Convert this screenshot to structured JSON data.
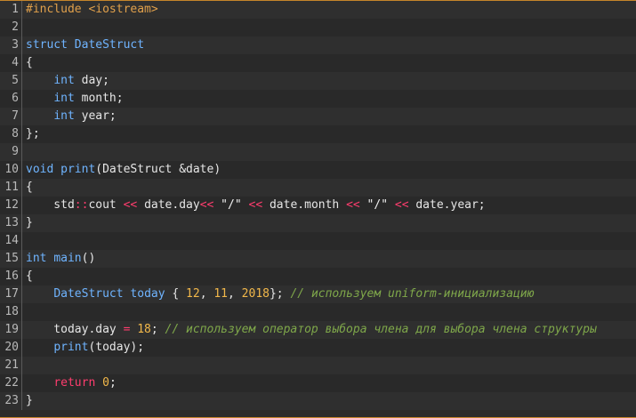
{
  "lines": [
    {
      "n": "1",
      "tokens": [
        {
          "t": "#include <iostream>",
          "c": "pre"
        }
      ]
    },
    {
      "n": "2",
      "tokens": []
    },
    {
      "n": "3",
      "tokens": [
        {
          "t": "struct",
          "c": "kw"
        },
        {
          "t": " ",
          "c": "plain"
        },
        {
          "t": "DateStruct",
          "c": "type"
        }
      ]
    },
    {
      "n": "4",
      "tokens": [
        {
          "t": "{",
          "c": "plain"
        }
      ]
    },
    {
      "n": "5",
      "tokens": [
        {
          "t": "    ",
          "c": "plain"
        },
        {
          "t": "int",
          "c": "kw"
        },
        {
          "t": " day;",
          "c": "plain"
        }
      ]
    },
    {
      "n": "6",
      "tokens": [
        {
          "t": "    ",
          "c": "plain"
        },
        {
          "t": "int",
          "c": "kw"
        },
        {
          "t": " month;",
          "c": "plain"
        }
      ]
    },
    {
      "n": "7",
      "tokens": [
        {
          "t": "    ",
          "c": "plain"
        },
        {
          "t": "int",
          "c": "kw"
        },
        {
          "t": " year;",
          "c": "plain"
        }
      ]
    },
    {
      "n": "8",
      "tokens": [
        {
          "t": "};",
          "c": "plain"
        }
      ]
    },
    {
      "n": "9",
      "tokens": []
    },
    {
      "n": "10",
      "tokens": [
        {
          "t": "void",
          "c": "kw"
        },
        {
          "t": " ",
          "c": "plain"
        },
        {
          "t": "print",
          "c": "kw"
        },
        {
          "t": "(DateStruct &date)",
          "c": "plain"
        }
      ]
    },
    {
      "n": "11",
      "tokens": [
        {
          "t": "{",
          "c": "plain"
        }
      ]
    },
    {
      "n": "12",
      "tokens": [
        {
          "t": "    std",
          "c": "plain"
        },
        {
          "t": "::",
          "c": "op"
        },
        {
          "t": "cout ",
          "c": "plain"
        },
        {
          "t": "<<",
          "c": "op"
        },
        {
          "t": " date.day",
          "c": "plain"
        },
        {
          "t": "<<",
          "c": "op"
        },
        {
          "t": " \"/\" ",
          "c": "str"
        },
        {
          "t": "<<",
          "c": "op"
        },
        {
          "t": " date.month ",
          "c": "plain"
        },
        {
          "t": "<<",
          "c": "op"
        },
        {
          "t": " \"/\" ",
          "c": "str"
        },
        {
          "t": "<<",
          "c": "op"
        },
        {
          "t": " date.year;",
          "c": "plain"
        }
      ]
    },
    {
      "n": "13",
      "tokens": [
        {
          "t": "}",
          "c": "plain"
        }
      ]
    },
    {
      "n": "14",
      "tokens": []
    },
    {
      "n": "15",
      "tokens": [
        {
          "t": "int",
          "c": "kw"
        },
        {
          "t": " ",
          "c": "plain"
        },
        {
          "t": "main",
          "c": "kw"
        },
        {
          "t": "()",
          "c": "plain"
        }
      ]
    },
    {
      "n": "16",
      "tokens": [
        {
          "t": "{",
          "c": "plain"
        }
      ]
    },
    {
      "n": "17",
      "tokens": [
        {
          "t": "    ",
          "c": "plain"
        },
        {
          "t": "DateStruct",
          "c": "type"
        },
        {
          "t": " ",
          "c": "plain"
        },
        {
          "t": "today",
          "c": "kw"
        },
        {
          "t": " { ",
          "c": "plain"
        },
        {
          "t": "12",
          "c": "num"
        },
        {
          "t": ", ",
          "c": "plain"
        },
        {
          "t": "11",
          "c": "num"
        },
        {
          "t": ", ",
          "c": "plain"
        },
        {
          "t": "2018",
          "c": "num"
        },
        {
          "t": "}; ",
          "c": "plain"
        },
        {
          "t": "// используем uniform-инициализацию",
          "c": "cmt"
        }
      ]
    },
    {
      "n": "18",
      "tokens": []
    },
    {
      "n": "19",
      "tokens": [
        {
          "t": "    today.day ",
          "c": "plain"
        },
        {
          "t": "=",
          "c": "op"
        },
        {
          "t": " ",
          "c": "plain"
        },
        {
          "t": "18",
          "c": "num"
        },
        {
          "t": "; ",
          "c": "plain"
        },
        {
          "t": "// используем оператор выбора члена для выбора члена структуры",
          "c": "cmt"
        }
      ]
    },
    {
      "n": "20",
      "tokens": [
        {
          "t": "    ",
          "c": "plain"
        },
        {
          "t": "print",
          "c": "kw"
        },
        {
          "t": "(today);",
          "c": "plain"
        }
      ]
    },
    {
      "n": "21",
      "tokens": []
    },
    {
      "n": "22",
      "tokens": [
        {
          "t": "    ",
          "c": "plain"
        },
        {
          "t": "return",
          "c": "ret"
        },
        {
          "t": " ",
          "c": "plain"
        },
        {
          "t": "0",
          "c": "num"
        },
        {
          "t": ";",
          "c": "plain"
        }
      ]
    },
    {
      "n": "23",
      "tokens": [
        {
          "t": "}",
          "c": "plain"
        }
      ]
    }
  ]
}
